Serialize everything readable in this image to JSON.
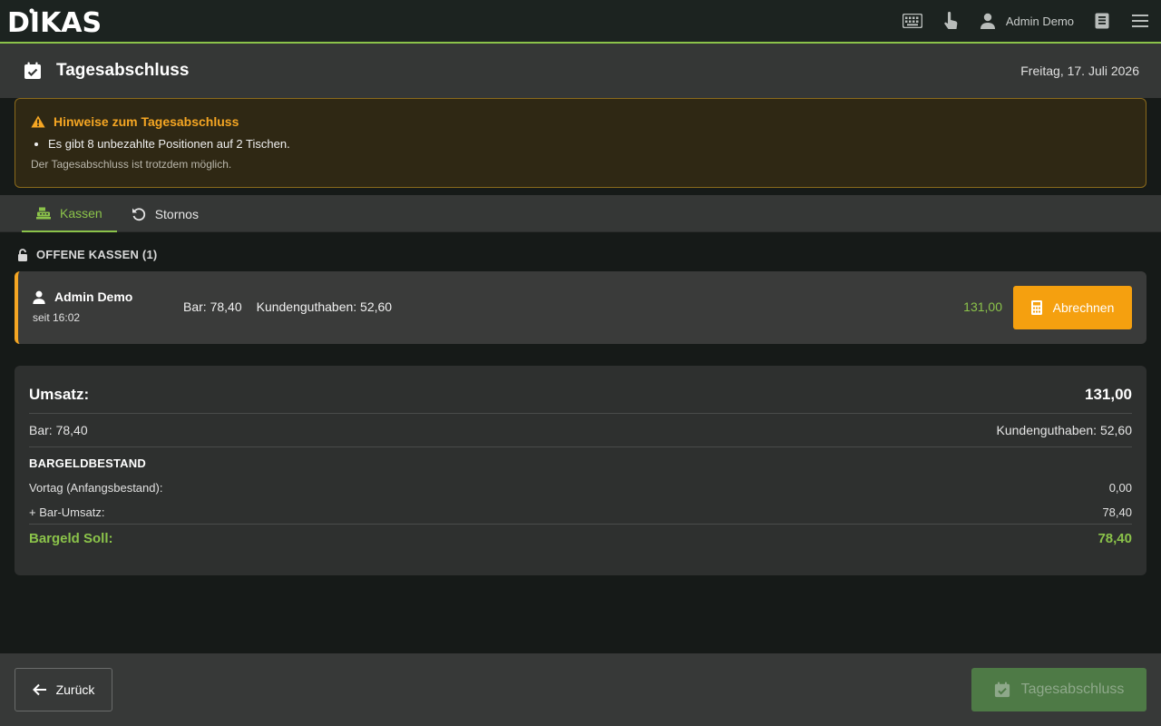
{
  "app": {
    "logo_text": "DIKAS"
  },
  "topbar": {
    "user_name": "Admin Demo"
  },
  "header": {
    "title": "Tagesabschluss",
    "date": "Freitag, 17. Juli 2026"
  },
  "notice": {
    "title": "Hinweise zum Tagesabschluss",
    "items": [
      "Es gibt 8 unbezahlte Positionen auf 2 Tischen."
    ],
    "subtext": "Der Tagesabschluss ist trotzdem möglich."
  },
  "tabs": [
    {
      "label": "Kassen",
      "active": true
    },
    {
      "label": "Stornos",
      "active": false
    }
  ],
  "open_registers": {
    "title": "OFFENE KASSEN (1)",
    "items": [
      {
        "user": "Admin Demo",
        "since": "seit 16:02",
        "cash": "Bar: 78,40",
        "credit": "Kundenguthaben: 52,60",
        "total": "131,00",
        "action_label": "Abrechnen"
      }
    ]
  },
  "summary": {
    "revenue_label": "Umsatz:",
    "revenue_value": "131,00",
    "cash_label": "Bar: 78,40",
    "credit_label": "Kundenguthaben: 52,60",
    "cash_section_title": "BARGELDBESTAND",
    "opening_label": "Vortag (Anfangsbestand):",
    "opening_value": "0,00",
    "cash_sales_label": "+ Bar-Umsatz:",
    "cash_sales_value": "78,40",
    "target_label": "Bargeld Soll:",
    "target_value": "78,40"
  },
  "footer": {
    "back_label": "Zurück",
    "close_label": "Tagesabschluss"
  },
  "colors": {
    "accent_green": "#8bc34a",
    "warning_orange": "#f5a623",
    "background": "#161a18"
  },
  "icons": {
    "keyboard": "keyboard-icon",
    "touch": "touch-icon",
    "user": "user-icon",
    "book": "book-icon",
    "menu": "menu-icon",
    "calendar_check": "calendar-check-icon",
    "warning": "warning-icon",
    "register": "register-icon",
    "undo": "undo-icon",
    "lock": "lock-open-icon",
    "calculator": "calculator-icon",
    "arrow_left": "arrow-left-icon"
  }
}
